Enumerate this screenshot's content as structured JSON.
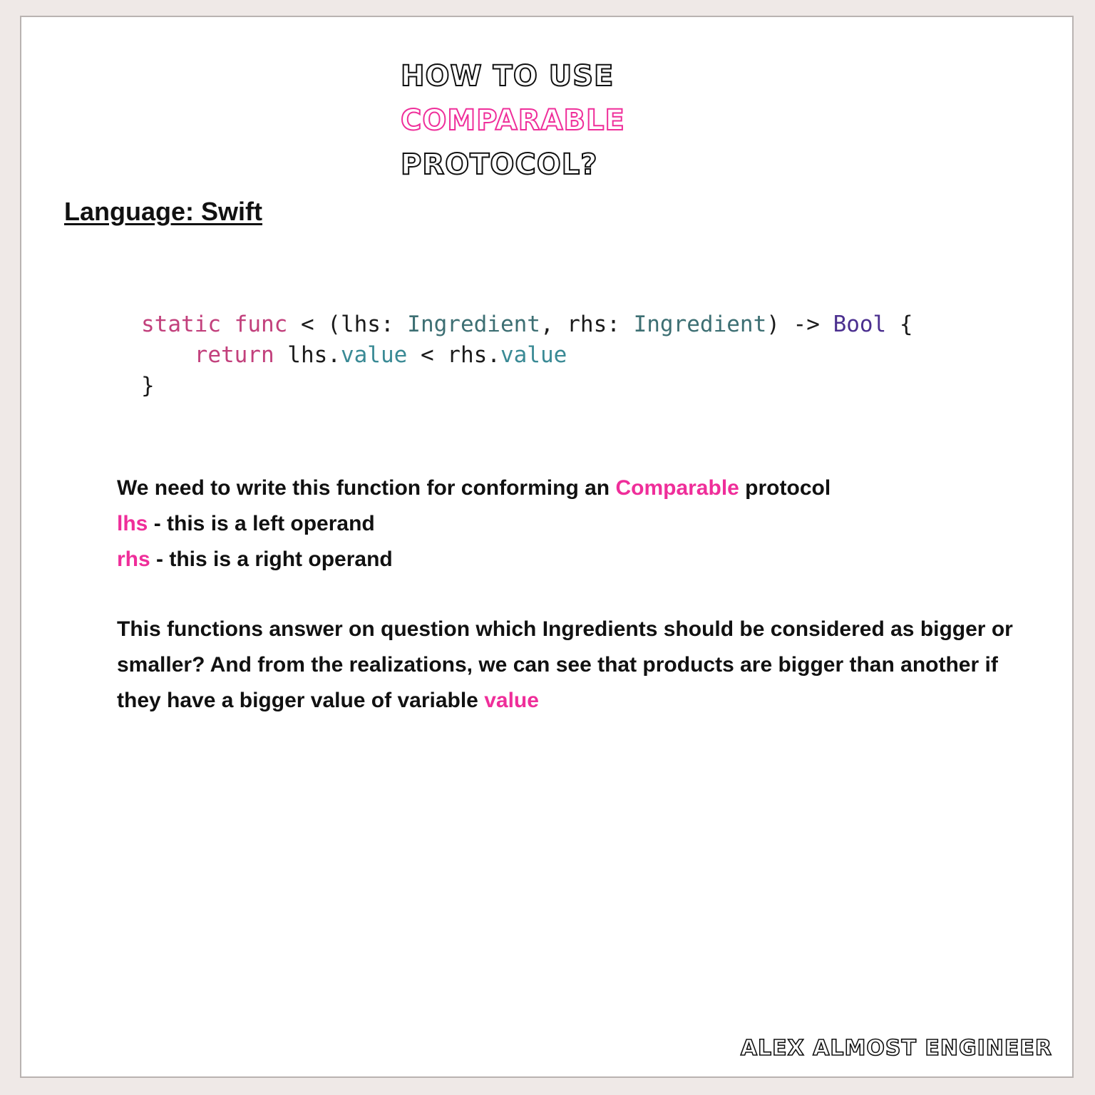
{
  "title": {
    "line1": "How to use",
    "line2": "Comparable",
    "line3": "protocol?"
  },
  "language_label": "Language: Swift",
  "code": {
    "line1": {
      "t1": "static",
      "t2": " ",
      "t3": "func",
      "t4": " < (lhs: ",
      "t5": "Ingredient",
      "t6": ", rhs: ",
      "t7": "Ingredient",
      "t8": ") -> ",
      "t9": "Bool",
      "t10": " {"
    },
    "line2": {
      "indent": "    ",
      "t1": "return",
      "t2": " lhs.",
      "t3": "value",
      "t4": " < rhs.",
      "t5": "value"
    },
    "line3": "}"
  },
  "description": {
    "line1_pre": "We need to write this function for conforming an ",
    "line1_accent": "Comparable",
    "line1_post": " protocol",
    "line2_accent": "lhs",
    "line2_post": " - this is a left operand",
    "line3_accent": "rhs",
    "line3_post": " - this is a right operand"
  },
  "paragraph": {
    "text": "This functions answer on question which Ingredients should be considered as bigger or smaller? And from the realizations, we can see that products are bigger than another if they have a bigger value  of variable ",
    "accent": "value"
  },
  "footer": "Alex Almost Engineer",
  "colors": {
    "accent": "#ef2e9a",
    "keyword": "#c2407c",
    "type": "#3d6f73",
    "property": "#3a8a95",
    "bool": "#4b2f8f",
    "text": "#111111",
    "frame": "#efe9e7"
  }
}
